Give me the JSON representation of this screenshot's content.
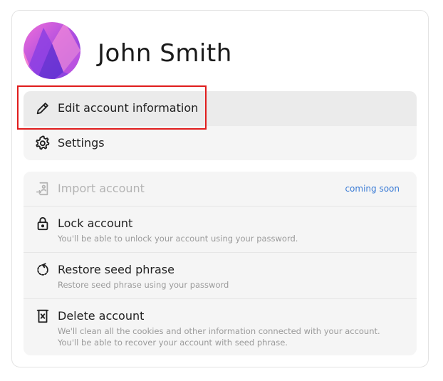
{
  "user": {
    "name": "John Smith"
  },
  "menu_primary": [
    {
      "label": "Edit account information",
      "icon": "pencil-icon",
      "active": true
    },
    {
      "label": "Settings",
      "icon": "gear-icon"
    }
  ],
  "menu_account": {
    "import": {
      "label": "Import account",
      "icon": "import-icon",
      "badge": "coming soon",
      "disabled": true
    },
    "lock": {
      "label": "Lock account",
      "description": "You'll be able to unlock your account using your password.",
      "icon": "lock-icon"
    },
    "restore": {
      "label": "Restore seed phrase",
      "description": "Restore seed phrase using your password",
      "icon": "restore-icon"
    },
    "delete": {
      "label": "Delete account",
      "description": "We'll clean all the cookies and other information connected with your account. You'll be able to recover your account with seed phrase.",
      "icon": "trash-icon"
    }
  },
  "colors": {
    "badge": "#3a7bd5",
    "highlight": "#e01c1c",
    "avatar_from": "#f06bd0",
    "avatar_to": "#6a38d8"
  }
}
